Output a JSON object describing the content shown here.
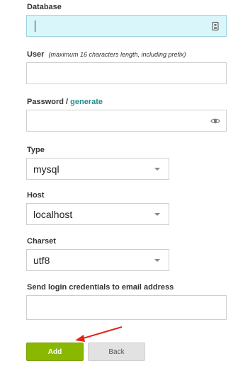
{
  "form": {
    "database": {
      "label": "Database",
      "value": ""
    },
    "user": {
      "label": "User",
      "note": "(maximum 16 characters length, including prefix)",
      "value": ""
    },
    "password": {
      "label": "Password",
      "separator": " / ",
      "generate_link": "generate",
      "value": ""
    },
    "type": {
      "label": "Type",
      "value": "mysql"
    },
    "host": {
      "label": "Host",
      "value": "localhost"
    },
    "charset": {
      "label": "Charset",
      "value": "utf8"
    },
    "email": {
      "label": "Send login credentials to email address",
      "value": ""
    }
  },
  "buttons": {
    "add": "Add",
    "back": "Back"
  },
  "icons": {
    "database_field": "contact-card-icon",
    "password_field": "eye-icon",
    "select_arrow": "chevron-down-icon",
    "annotation": "red-arrow-icon"
  },
  "colors": {
    "focus_bg": "#d9f6fb",
    "link": "#2a8c8c",
    "add_button": "#8ab800",
    "back_button": "#e2e2e2",
    "annotation": "#e0261b"
  }
}
